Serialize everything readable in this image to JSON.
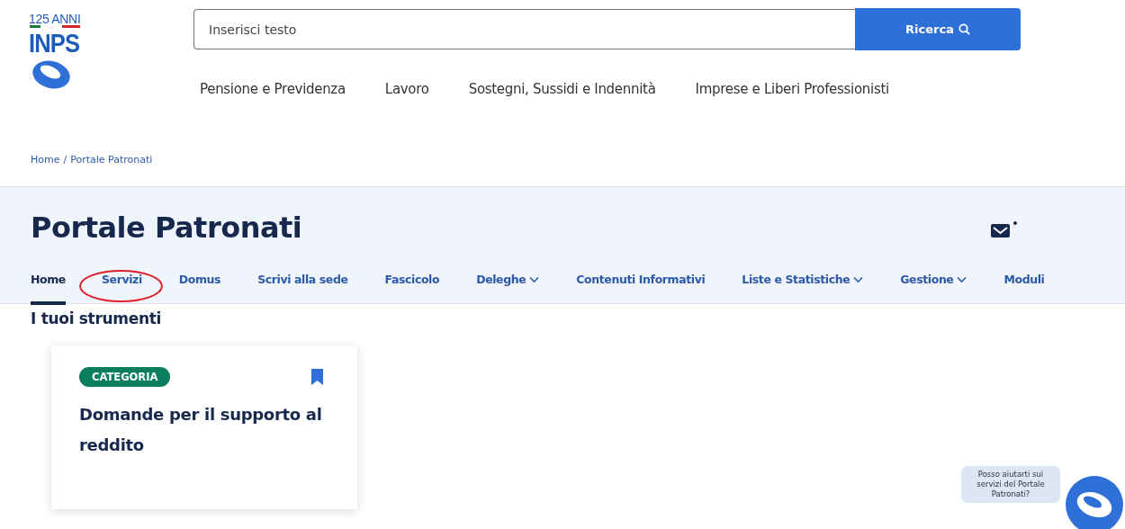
{
  "logo": {
    "anniversary": "125 ANNI",
    "name": "INPS"
  },
  "search": {
    "placeholder": "Inserisci testo",
    "button": "Ricerca"
  },
  "main_nav": [
    "Pensione e Previdenza",
    "Lavoro",
    "Sostegni, Sussidi e Indennità",
    "Imprese e Liberi Professionisti"
  ],
  "breadcrumb": {
    "separator": "/",
    "items": [
      "Home",
      "Portale Patronati"
    ]
  },
  "page_title": "Portale Patronati",
  "mail": {
    "unread": true
  },
  "tabs": [
    {
      "label": "Home",
      "selected": true,
      "dropdown": false,
      "circled": false
    },
    {
      "label": "Servizi",
      "selected": false,
      "dropdown": false,
      "circled": true
    },
    {
      "label": "Domus",
      "selected": false,
      "dropdown": false,
      "circled": false
    },
    {
      "label": "Scrivi alla sede",
      "selected": false,
      "dropdown": false,
      "circled": false
    },
    {
      "label": "Fascicolo",
      "selected": false,
      "dropdown": false,
      "circled": false
    },
    {
      "label": "Deleghe",
      "selected": false,
      "dropdown": true,
      "circled": false
    },
    {
      "label": "Contenuti Informativi",
      "selected": false,
      "dropdown": false,
      "circled": false
    },
    {
      "label": "Liste e Statistiche",
      "selected": false,
      "dropdown": true,
      "circled": false
    },
    {
      "label": "Gestione",
      "selected": false,
      "dropdown": true,
      "circled": false
    },
    {
      "label": "Moduli",
      "selected": false,
      "dropdown": false,
      "circled": false
    }
  ],
  "section_title": "I tuoi strumenti",
  "cards": [
    {
      "tag": "CATEGORIA",
      "title": "Domande per il supporto al reddito",
      "bookmarked": true
    }
  ],
  "chat": {
    "prompt": "Posso aiutarti sui servizi del Portale Patronati?"
  }
}
